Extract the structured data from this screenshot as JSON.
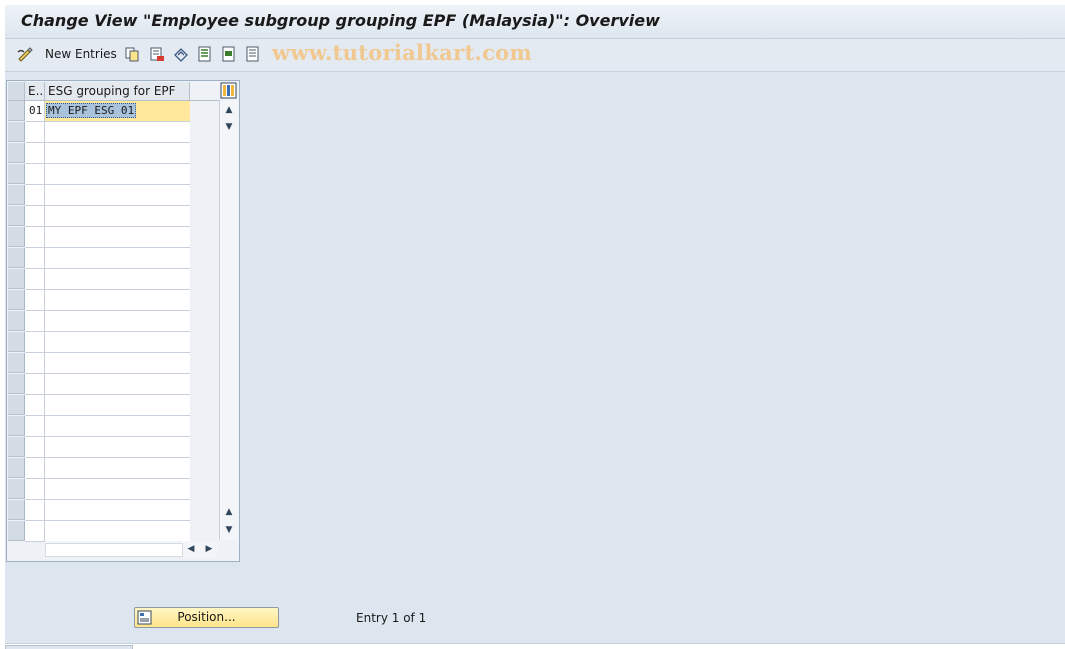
{
  "window": {
    "title": "Change View \"Employee subgroup grouping EPF (Malaysia)\": Overview"
  },
  "toolbar": {
    "new_entries_label": "New Entries",
    "icons": [
      "glasses-edit-icon",
      "copy-icon",
      "delete-icon",
      "undo-icon",
      "select-all-icon",
      "select-block-icon",
      "deselect-all-icon"
    ]
  },
  "watermark": "www.tutorialkart.com",
  "table": {
    "columns": [
      "E..",
      "ESG grouping for EPF"
    ],
    "rows": [
      {
        "code": "01",
        "name": "MY EPF ESG 01"
      }
    ],
    "empty_row_count": 20
  },
  "footer": {
    "position_label": "Position...",
    "entry_info": "Entry 1 of 1"
  },
  "colors": {
    "background": "#dde6ef",
    "active_row": "#ffe79c",
    "position_button": "#ffe58a",
    "watermark": "#f0c890"
  }
}
